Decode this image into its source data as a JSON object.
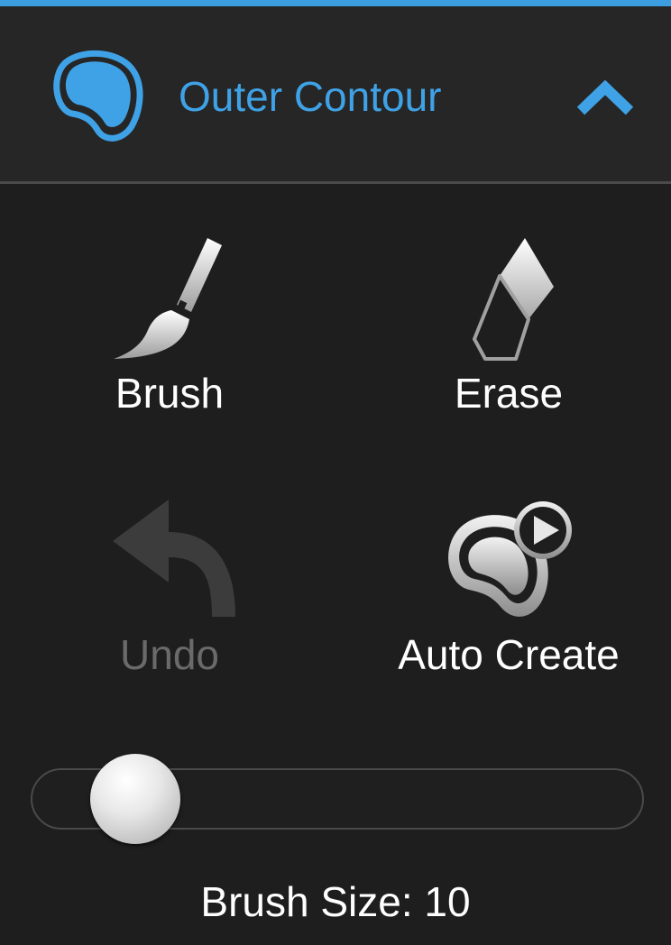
{
  "panel": {
    "title": "Outer Contour",
    "accent_color": "#3a9ee0",
    "header_icon": "contour-shape-icon",
    "collapse_icon": "chevron-up-icon"
  },
  "tools": {
    "brush": {
      "label": "Brush",
      "icon": "brush-icon",
      "enabled": true
    },
    "erase": {
      "label": "Erase",
      "icon": "eraser-icon",
      "enabled": true
    },
    "undo": {
      "label": "Undo",
      "icon": "undo-arrow-icon",
      "enabled": false
    },
    "auto_create": {
      "label": "Auto Create",
      "icon": "auto-create-contour-play-icon",
      "enabled": true
    }
  },
  "brush_size": {
    "caption": "Brush Size: 10",
    "value": 10
  }
}
